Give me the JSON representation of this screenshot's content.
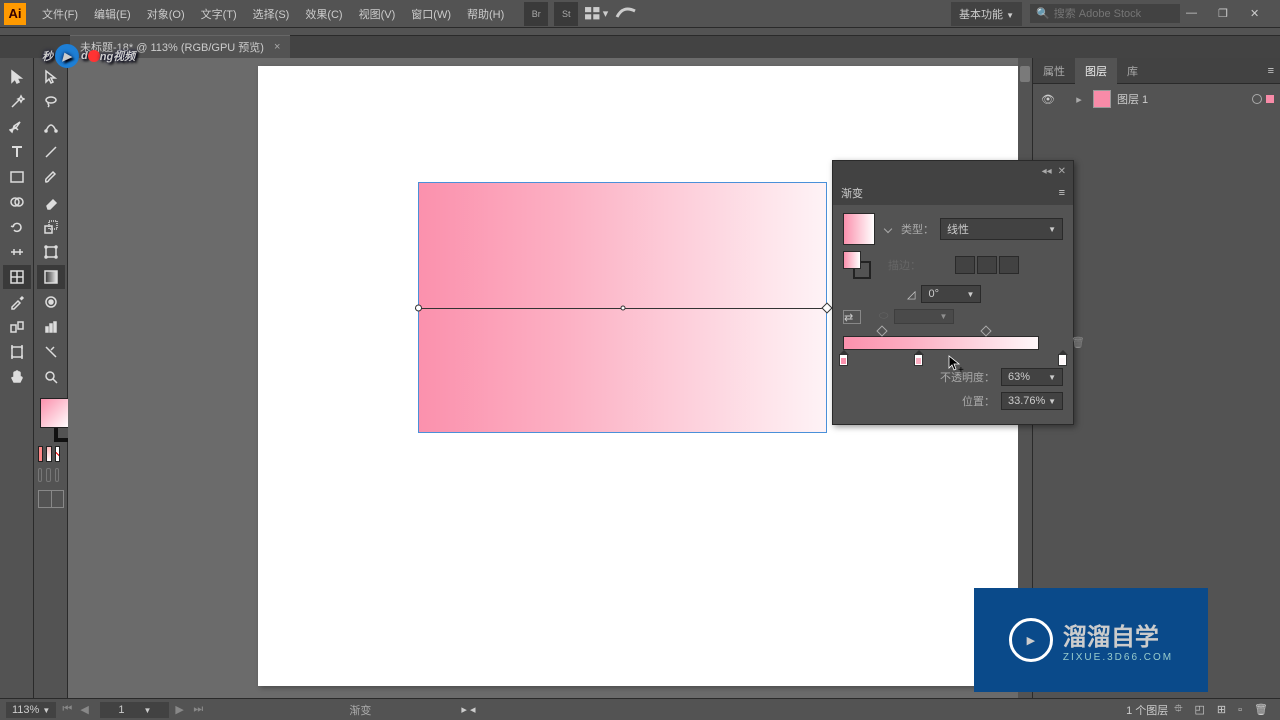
{
  "menubar": {
    "items": [
      "文件(F)",
      "编辑(E)",
      "对象(O)",
      "文字(T)",
      "选择(S)",
      "效果(C)",
      "视图(V)",
      "窗口(W)",
      "帮助(H)"
    ],
    "workspace": "基本功能",
    "search_placeholder": "搜索 Adobe Stock"
  },
  "document": {
    "tab_title": "未标题-18* @ 113% (RGB/GPU 预览)"
  },
  "panels": {
    "right_tabs": [
      "属性",
      "图层",
      "库"
    ],
    "active_tab": 1,
    "layer": {
      "name": "图层 1"
    }
  },
  "gradient_panel": {
    "title": "渐变",
    "type_label": "类型：",
    "type_value": "线性",
    "stroke_label": "描边：",
    "angle_value": "0°",
    "opacity_label": "不透明度：",
    "opacity_value": "63%",
    "location_label": "位置：",
    "location_value": "33.76%",
    "stops": {
      "opacity_stops": [
        17,
        64
      ],
      "color_stops": [
        {
          "pos": 0,
          "color": "#fb91ad"
        },
        {
          "pos": 34,
          "color": "#fcaec2"
        },
        {
          "pos": 100,
          "color": "#fef7f9"
        }
      ]
    }
  },
  "status": {
    "zoom": "113%",
    "page": "1",
    "tool": "渐变",
    "layer_count": "1 个图层"
  },
  "watermark1": {
    "a": "秒",
    "b": "d",
    "c": "ng视频"
  },
  "watermark2": {
    "title": "溜溜自学",
    "sub": "ZIXUE.3D66.COM"
  }
}
